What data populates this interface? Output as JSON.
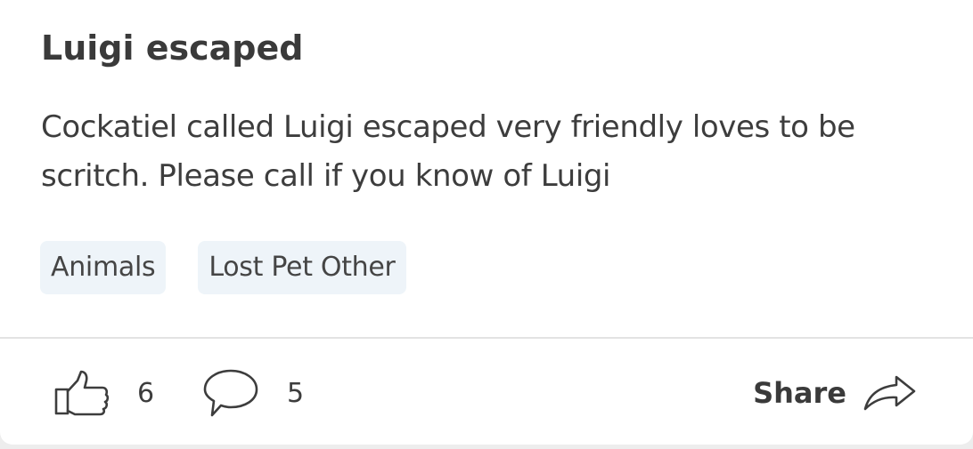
{
  "post": {
    "title": "Luigi escaped",
    "body": "Cockatiel called Luigi escaped very friendly loves to be scritch. Please call if you know of Luigi",
    "tags": [
      "Animals",
      "Lost Pet Other"
    ]
  },
  "actions": {
    "like_count": "6",
    "comment_count": "5",
    "share_label": "Share",
    "like_icon": "thumbs-up-icon",
    "comment_icon": "speech-bubble-icon",
    "share_icon": "share-arrow-icon"
  },
  "colors": {
    "text": "#3d3d3d",
    "tag_background": "#eef4f9",
    "divider": "#e3e3e3"
  }
}
